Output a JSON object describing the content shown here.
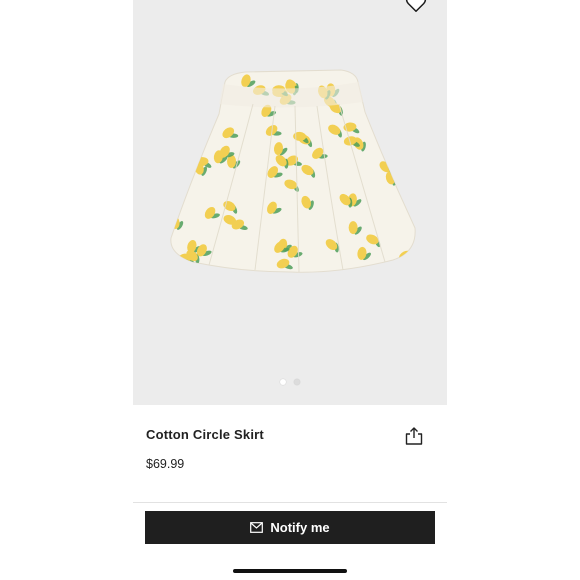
{
  "product": {
    "name": "Cotton Circle Skirt",
    "price": "$69.99"
  },
  "gallery": {
    "image_subject": "lemon print cotton circle skirt",
    "page_count": 2,
    "active_page": 1
  },
  "actions": {
    "notify_label": "Notify me"
  },
  "icons": {
    "wishlist": "heart-icon",
    "share": "share-icon",
    "notify": "mail-icon"
  },
  "colors": {
    "photo_background": "#ececec",
    "button_background": "#1f1f1f",
    "button_text": "#ffffff",
    "skirt_base": "#f6f3ea",
    "lemon": "#f2cf52",
    "leaf": "#4f9d5a"
  }
}
